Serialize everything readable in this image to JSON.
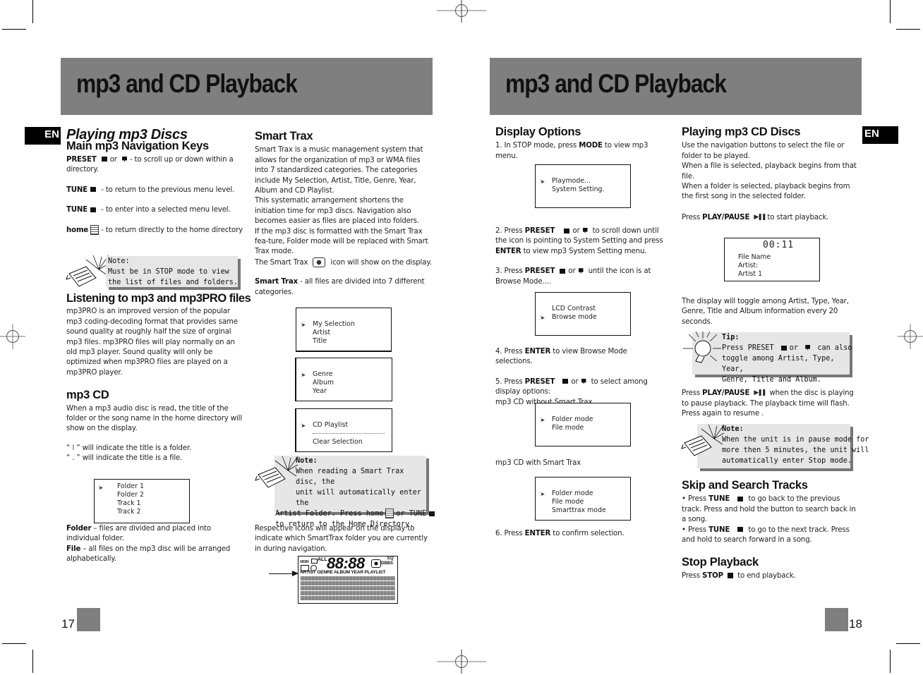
{
  "left_page": {
    "banner_title": "mp3 and CD Playback",
    "lang_tab": "EN",
    "page_number": "17",
    "col1": {
      "title": "Playing mp3 Discs",
      "subtitle": "Main mp3 Navigation Keys",
      "keys": [
        {
          "key": "PRESET",
          "icons": [
            "preset-up-icon",
            "preset-down-icon"
          ],
          "connector": "or",
          "text": "- to scroll up or down within a directory."
        },
        {
          "key": "TUNE",
          "icons": [
            "tune-back-icon"
          ],
          "text": "- to return to the previous menu level."
        },
        {
          "key": "TUNE",
          "icons": [
            "tune-forward-icon"
          ],
          "text": "- to enter into a selected menu level."
        },
        {
          "key": "home",
          "icons": [
            "home-icon"
          ],
          "text": "- to return directly to the home  directory"
        }
      ],
      "note": {
        "label": "Note:",
        "text": "Must be in STOP mode to view the list of files and folders."
      },
      "section2_title": "Listening to mp3 and mp3PRO files",
      "section2_body": "mp3PRO is an improved version of the popular mp3 coding-decoding format that provides same  sound quality at roughly half the size of orginal mp3 files. mp3PRO files will play normally on an old mp3 player. Sound quality will only be optimized when mp3PRO files are played on a mp3PRO  player.",
      "section3_title": "mp3 CD",
      "section3_body": "When a mp3 audio disc is read, the title of the folder or the song name in the home directory will show on the display.",
      "folder_indicator": "“  ⁞  ” will indicate the title is a folder.",
      "file_indicator": "“  . ” will indicate the title is a file.",
      "display": [
        "Folder 1",
        "Folder 2",
        "Track 1",
        "Track 2"
      ],
      "folder_def_key": "Folder",
      "folder_def": " – files are divided and placed into individual folder.",
      "file_def_key": "File",
      "file_def": " – all files on the mp3 disc will be arranged alphabetically."
    },
    "col2": {
      "title": "Smart Trax",
      "p1": "Smart Trax is a music management system that allows for the organization of  mp3  or WMA files  into 7 standardized categories.  The categories include My Selection, Artist, Title, Genre, Year, Album and CD Playlist.",
      "p2": "This systematic arrangement shortens the initiation time for mp3 discs. Navigation also becomes easier as files are placed into folders.",
      "p3": "If the mp3 disc is formatted with the Smart Trax  fea-ture, Folder mode will be replaced with Smart Trax mode.",
      "p4_pre": "The Smart Trax",
      "p4_post": "icon will show on the display.",
      "p5_key": "Smart Trax",
      "p5": "  - all files are divided into 7 different categories.",
      "display1": [
        "My Selection",
        "Artist",
        "Title"
      ],
      "display2": [
        "Genre",
        "Album",
        "Year"
      ],
      "display3": [
        "CD Playlist",
        "Clear Selection"
      ],
      "note": {
        "label": "Note:",
        "l1": "When reading a Smart Trax disc, the",
        "l2": "unit will automatically enter the",
        "l3_pre": "Artist Folder. Press home",
        "l3_mid": "or TUNE",
        "l4": "to return to the Home Directory."
      },
      "p6": "Respective icons will appear on the display to indicate which SmartTrax folder you are currently in during navigation.",
      "lcd": {
        "digits": "88:88",
        "all": "ALL",
        "eq": "EQ",
        "dbbs": "DBBS",
        "categories": "ARTIST GENRE ALBUM YEAR PLAYLIST"
      }
    }
  },
  "right_page": {
    "banner_title": "mp3 and CD Playback",
    "lang_tab": "EN",
    "page_number": "18",
    "col1": {
      "title": "Display Options",
      "step1_pre": "1. In STOP mode, press ",
      "step1_key": "MODE",
      "step1_post": " to view mp3 menu.",
      "display1": [
        "Playmode...",
        "System Setting."
      ],
      "step2_pre": "2. Press ",
      "step2_key": "PRESET",
      "step2_mid": "or",
      "step2_post": "to scroll down until the icon is pointing to System Setting and press ",
      "step2_key2": "ENTER",
      "step2_end": " to view mp3 System Setting menu.",
      "step3_pre": "3.  Press ",
      "step3_key": "PRESET",
      "step3_mid": "or",
      "step3_post": "until the icon is at Browse Mode....",
      "display2": [
        "LCD Contrast",
        "Browse mode"
      ],
      "step4_pre": "4.  Press ",
      "step4_key": "ENTER",
      "step4_post": " to view Browse Mode selections.",
      "step5_pre": "5.  Press ",
      "step5_key": "PRESET",
      "step5_mid": "or",
      "step5_post": "to select among display options:",
      "without_label": "mp3 CD without Smart Trax",
      "display3": [
        "Folder mode",
        "File mode"
      ],
      "with_label": "mp3 CD with Smart Trax",
      "display4": [
        "Folder mode",
        "File mode",
        "Smarttrax mode"
      ],
      "step6_pre": "6.  Press ",
      "step6_key": "ENTER",
      "step6_post": " to confirm selection."
    },
    "col2": {
      "title": "Playing mp3 CD Discs",
      "p1": "Use the navigation buttons to select the file or folder to be played.",
      "p2": "When a file is selected, playback begins from that file.",
      "p3": "When a folder is selected, playback begins from the first song in the selected folder.",
      "p4_pre": "Press ",
      "p4_key": "PLAY/PAUSE",
      "p4_post": "to start playback.",
      "display": {
        "time": "00:11",
        "lines": [
          "File Name",
          "Artist:",
          "Artist 1"
        ]
      },
      "p5": "The display will toggle among Artist, Type, Year, Genre, Title and Album information every 20 seconds.",
      "tip": {
        "label": "Tip:",
        "l1_pre": "Press PRESET",
        "l1_mid": "or",
        "l1_post": "can also",
        "l2": "toggle among Artist, Type, Year,",
        "l3": "Genre, Title and Album."
      },
      "p6_pre": "Press ",
      "p6_key": "PLAY/PAUSE",
      "p6_post": "when the disc is playing to pause playback. The playback time will flash.",
      "p6b": "Press again to resume .",
      "note": {
        "label": "Note:",
        "l1": "When the unit is in pause mode for",
        "l2": "more then 5 minutes, the unit will",
        "l3": "automatically enter Stop mode."
      },
      "skip_title": "Skip and Search Tracks",
      "skip1_pre": "•  Press ",
      "skip1_key": "TUNE",
      "skip1_post": "to go back to the previous track. Press and hold the button to search back in a song.",
      "skip2_pre": "•  Press ",
      "skip2_key": "TUNE",
      "skip2_post": "to go to the next track. Press and hold to search forward in a song.",
      "stop_title": "Stop Playback",
      "stop_pre": "Press ",
      "stop_key": "STOP",
      "stop_post": "to end playback."
    }
  }
}
